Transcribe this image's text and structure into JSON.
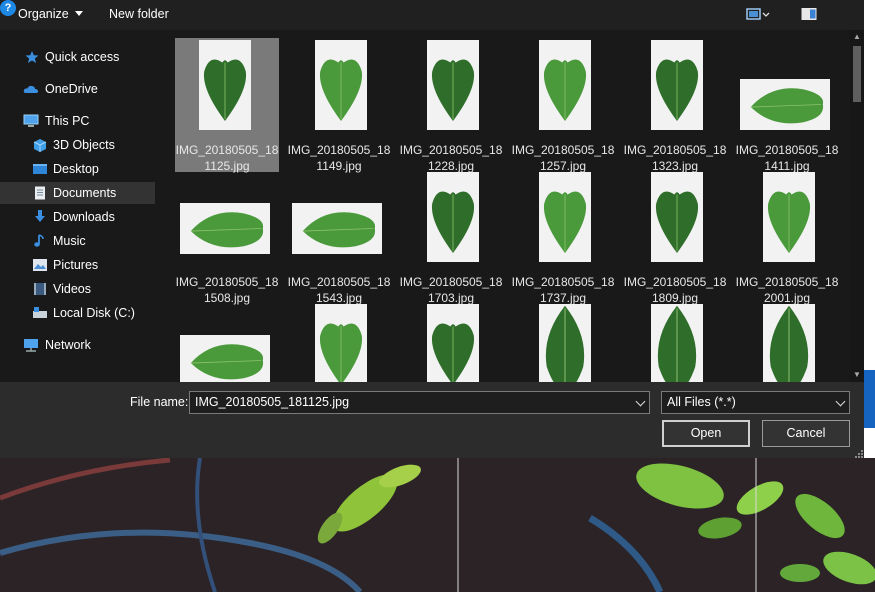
{
  "toolbar": {
    "organize_label": "Organize",
    "new_folder_label": "New folder",
    "view_icon": "view-options-icon",
    "pane_icon": "preview-pane-icon",
    "help_label": "?"
  },
  "nav": {
    "items": [
      {
        "label": "Quick access",
        "icon": "star-icon"
      },
      {
        "label": "OneDrive",
        "icon": "cloud-icon"
      },
      {
        "label": "This PC",
        "icon": "computer-icon"
      },
      {
        "label": "3D Objects",
        "icon": "cube-icon"
      },
      {
        "label": "Desktop",
        "icon": "desktop-icon"
      },
      {
        "label": "Documents",
        "icon": "document-icon"
      },
      {
        "label": "Downloads",
        "icon": "download-icon"
      },
      {
        "label": "Music",
        "icon": "music-icon"
      },
      {
        "label": "Pictures",
        "icon": "pictures-icon"
      },
      {
        "label": "Videos",
        "icon": "videos-icon"
      },
      {
        "label": "Local Disk (C:)",
        "icon": "drive-icon"
      },
      {
        "label": "Network",
        "icon": "network-icon"
      }
    ],
    "selected": "Documents"
  },
  "files": [
    {
      "line1": "IMG_20180505_18",
      "line2": "1125.jpg",
      "selected": true
    },
    {
      "line1": "IMG_20180505_18",
      "line2": "1149.jpg"
    },
    {
      "line1": "IMG_20180505_18",
      "line2": "1228.jpg"
    },
    {
      "line1": "IMG_20180505_18",
      "line2": "1257.jpg"
    },
    {
      "line1": "IMG_20180505_18",
      "line2": "1323.jpg"
    },
    {
      "line1": "IMG_20180505_18",
      "line2": "1411.jpg"
    },
    {
      "line1": "IMG_20180505_18",
      "line2": "1508.jpg"
    },
    {
      "line1": "IMG_20180505_18",
      "line2": "1543.jpg"
    },
    {
      "line1": "IMG_20180505_18",
      "line2": "1703.jpg"
    },
    {
      "line1": "IMG_20180505_18",
      "line2": "1737.jpg"
    },
    {
      "line1": "IMG_20180505_18",
      "line2": "1809.jpg"
    },
    {
      "line1": "IMG_20180505_18",
      "line2": "2001.jpg"
    },
    {
      "line1": "",
      "line2": ""
    },
    {
      "line1": "",
      "line2": ""
    },
    {
      "line1": "",
      "line2": ""
    },
    {
      "line1": "",
      "line2": ""
    },
    {
      "line1": "",
      "line2": ""
    },
    {
      "line1": "",
      "line2": ""
    }
  ],
  "footer": {
    "file_name_label": "File name:",
    "file_name_value": "IMG_20180505_181125.jpg",
    "file_type_value": "All Files (*.*)",
    "open_label": "Open",
    "cancel_label": "Cancel"
  },
  "colors": {
    "leaf_dark": "#2f6e2a",
    "leaf_light": "#4a9a3c",
    "accent": "#1e88e5"
  }
}
